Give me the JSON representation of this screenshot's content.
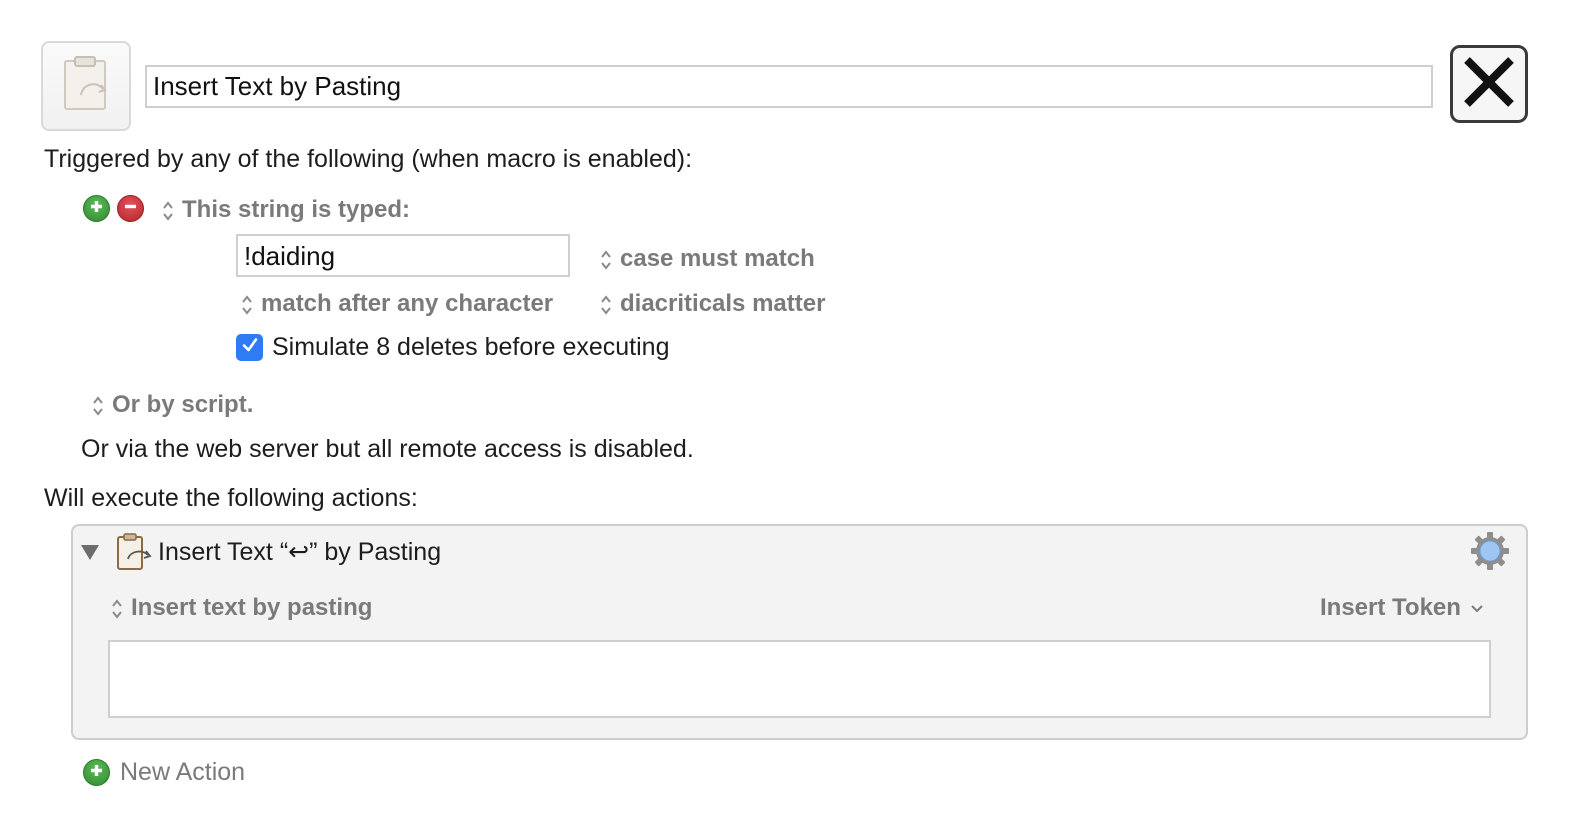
{
  "macro": {
    "name": "Insert Text by Pasting",
    "icon": "clipboard-paste-icon"
  },
  "header": {
    "close_icon": "close-x-icon"
  },
  "triggers": {
    "heading": "Triggered by any of the following (when macro is enabled):",
    "typed_string": {
      "label": "This string is typed:",
      "value": "!daiding",
      "case_option": "case must match",
      "match_option": "match after any character",
      "diacritics_option": "diacriticals matter",
      "simulate_label": "Simulate 8 deletes before executing",
      "simulate_checked": true
    },
    "script_label": "Or by script.",
    "web_server_note": "Or via the web server but all remote access is disabled."
  },
  "actions": {
    "heading": "Will execute the following actions:",
    "items": [
      {
        "title_prefix": "Insert Text “",
        "title_symbol": "↩",
        "title_suffix": "” by Pasting",
        "mode_label": "Insert text by pasting",
        "insert_token_label": "Insert Token",
        "text_value": ""
      }
    ],
    "new_action_label": "New Action"
  },
  "colors": {
    "add_green": "#2f8a2e",
    "remove_red": "#b5242b",
    "checkbox_blue": "#2f7bf5",
    "secondary_grey": "#7a7a7a"
  }
}
